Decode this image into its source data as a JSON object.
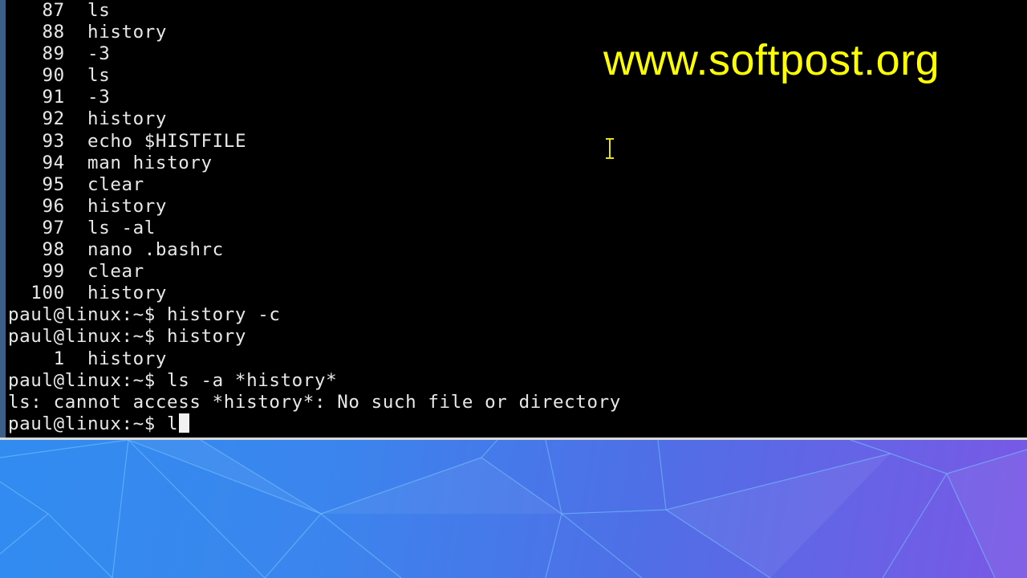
{
  "terminal": {
    "history_entries": [
      {
        "num": "87",
        "cmd": "ls"
      },
      {
        "num": "88",
        "cmd": "history"
      },
      {
        "num": "89",
        "cmd": "-3"
      },
      {
        "num": "90",
        "cmd": "ls"
      },
      {
        "num": "91",
        "cmd": "-3"
      },
      {
        "num": "92",
        "cmd": "history"
      },
      {
        "num": "93",
        "cmd": "echo $HISTFILE"
      },
      {
        "num": "94",
        "cmd": "man history"
      },
      {
        "num": "95",
        "cmd": "clear"
      },
      {
        "num": "96",
        "cmd": "history"
      },
      {
        "num": "97",
        "cmd": "ls -al"
      },
      {
        "num": "98",
        "cmd": "nano .bashrc"
      },
      {
        "num": "99",
        "cmd": "clear"
      },
      {
        "num": "100",
        "cmd": "history"
      }
    ],
    "lines": [
      "paul@linux:~$ history -c",
      "paul@linux:~$ history",
      "    1  history",
      "paul@linux:~$ ls -a *history*",
      "ls: cannot access *history*: No such file or directory"
    ],
    "current_prompt": "paul@linux:~$ l",
    "colors": {
      "background": "#000000",
      "text": "#e8e8e8"
    }
  },
  "watermark": {
    "text": "www.softpost.org",
    "color": "#ffff00"
  },
  "mouse_cursor": {
    "icon": "ibeam-cursor-icon"
  },
  "desktop": {
    "wallpaper": "blue-purple low-poly gradient"
  }
}
